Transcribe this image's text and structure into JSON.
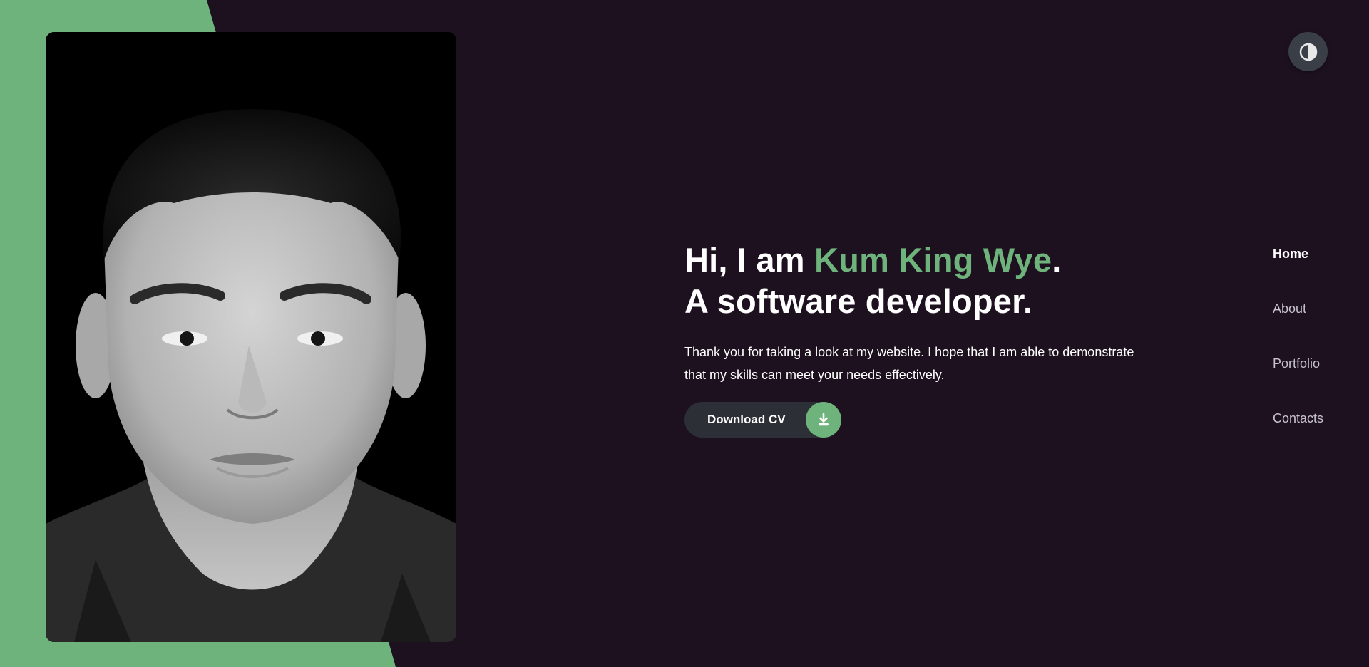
{
  "hero": {
    "greeting_prefix": "Hi, I am ",
    "name": "Kum King Wye",
    "period": ".",
    "role_line": "A software developer.",
    "intro": "Thank you for taking a look at my website. I hope that I am able to demonstrate that my skills can meet your needs effectively."
  },
  "cv_button": {
    "label": "Download CV",
    "icon": "download-icon"
  },
  "theme_toggle": {
    "icon": "contrast-icon"
  },
  "nav": {
    "items": [
      {
        "label": "Home",
        "active": true
      },
      {
        "label": "About",
        "active": false
      },
      {
        "label": "Portfolio",
        "active": false
      },
      {
        "label": "Contacts",
        "active": false
      }
    ]
  },
  "photo": {
    "description_icon": "portrait-photo"
  },
  "colors": {
    "background": "#1d111f",
    "accent": "#6fb37c",
    "button_dark": "#2c3036",
    "toggle": "#3a3f47"
  }
}
